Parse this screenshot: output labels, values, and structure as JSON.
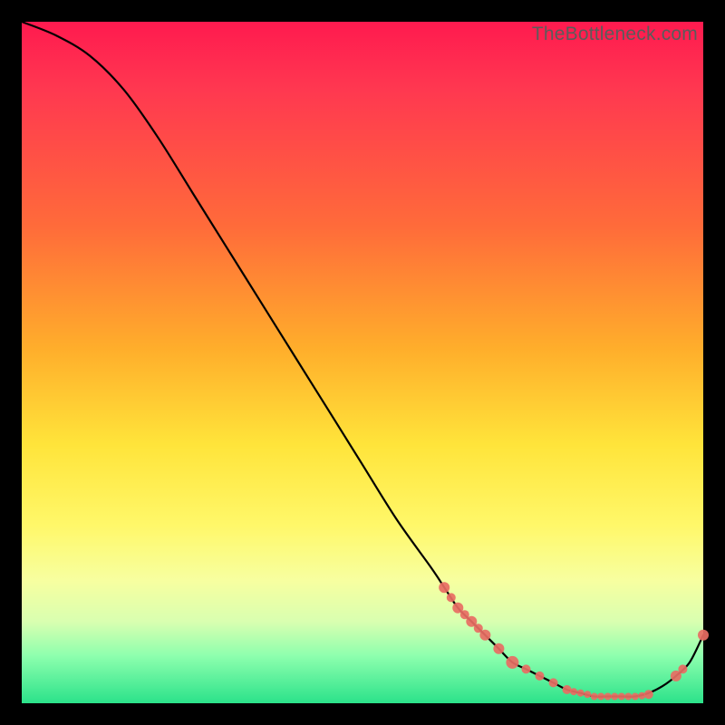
{
  "watermark": "TheBottleneck.com",
  "chart_data": {
    "type": "line",
    "title": "",
    "xlabel": "",
    "ylabel": "",
    "xlim": [
      0,
      100
    ],
    "ylim": [
      0,
      100
    ],
    "series": [
      {
        "name": "bottleneck-curve",
        "x": [
          0,
          5,
          10,
          15,
          20,
          25,
          30,
          35,
          40,
          45,
          50,
          55,
          60,
          62,
          64,
          66,
          68,
          70,
          72,
          74,
          76,
          78,
          80,
          82,
          84,
          86,
          88,
          90,
          92,
          94,
          96,
          98,
          100
        ],
        "values": [
          100,
          98,
          95,
          90,
          83,
          75,
          67,
          59,
          51,
          43,
          35,
          27,
          20,
          17,
          14,
          12,
          10,
          8,
          6,
          5,
          4,
          3,
          2,
          1.5,
          1,
          1,
          1,
          1,
          1.5,
          2.5,
          4,
          6,
          10
        ]
      }
    ],
    "markers": {
      "name": "highlight-markers",
      "x": [
        62,
        63,
        64,
        65,
        66,
        67,
        68,
        70,
        72,
        74,
        76,
        78,
        80,
        81,
        82,
        83,
        84,
        85,
        86,
        87,
        88,
        89,
        90,
        91,
        92,
        96,
        97,
        100
      ],
      "values": [
        17,
        15.5,
        14,
        13,
        12,
        11,
        10,
        8,
        6,
        5,
        4,
        3,
        2,
        1.7,
        1.5,
        1.3,
        1,
        1,
        1,
        1,
        1,
        1,
        1,
        1.1,
        1.3,
        4,
        5,
        10
      ],
      "size": [
        6,
        5,
        6,
        5,
        6,
        5,
        6,
        6,
        7,
        5,
        5,
        5,
        5,
        4,
        4,
        4,
        4,
        4,
        4,
        4,
        4,
        4,
        4,
        4,
        5,
        6,
        5,
        6
      ]
    },
    "colors": {
      "curve": "#000000",
      "marker": "#e86d63"
    }
  }
}
